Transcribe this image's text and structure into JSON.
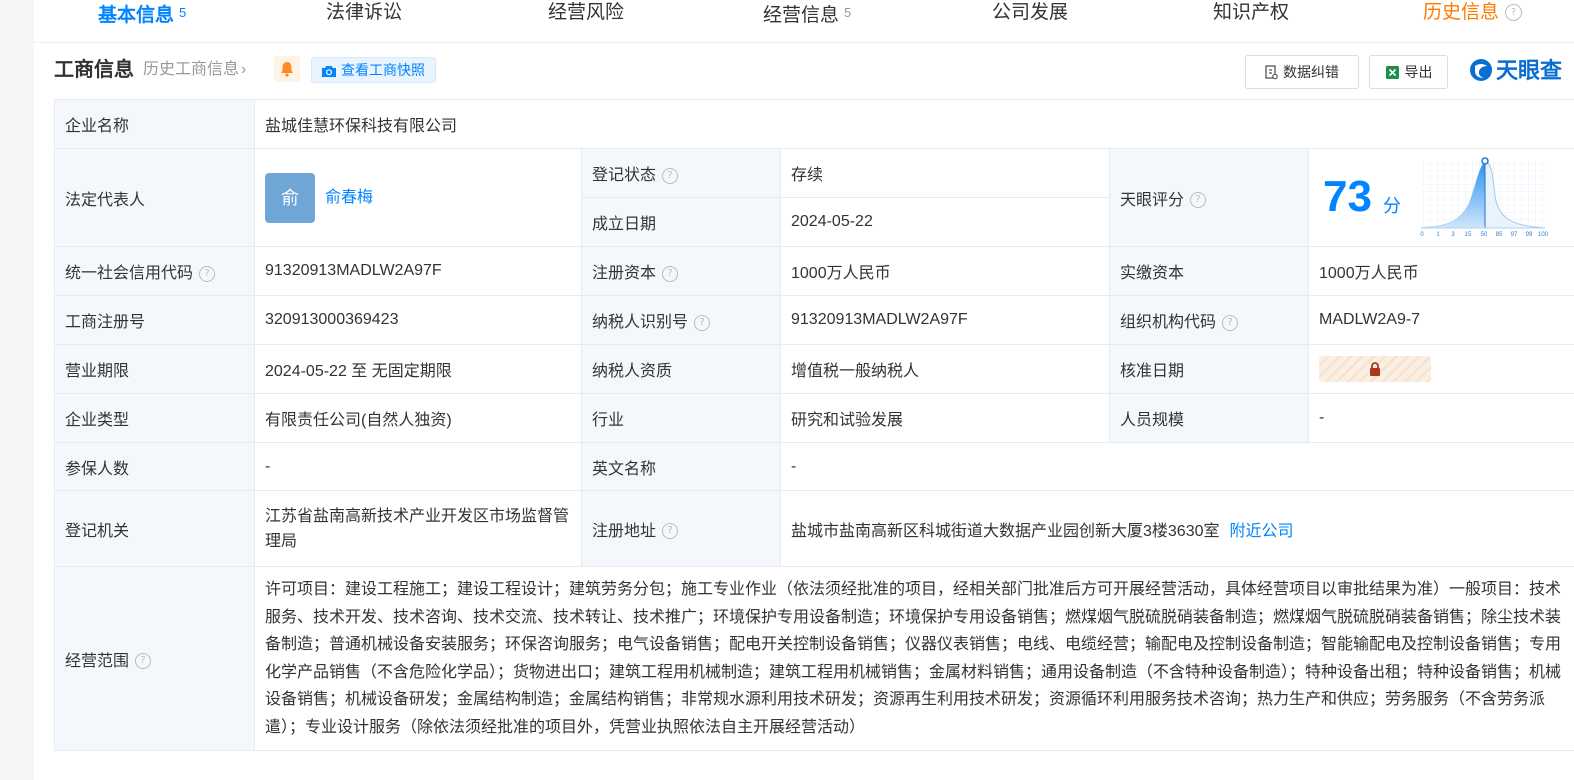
{
  "tabs": [
    {
      "label": "基本信息",
      "count": "5"
    },
    {
      "label": "法律诉讼"
    },
    {
      "label": "经营风险"
    },
    {
      "label": "经营信息",
      "count": "5"
    },
    {
      "label": "公司发展"
    },
    {
      "label": "知识产权"
    },
    {
      "label": "历史信息"
    }
  ],
  "section": {
    "title": "工商信息",
    "history_link": "历史工商信息",
    "snapshot_btn": "查看工商快照",
    "correct_btn": "数据纠错",
    "export_btn": "导出",
    "brand": "天眼查"
  },
  "info": {
    "company_name_label": "企业名称",
    "company_name": "盐城佳慧环保科技有限公司",
    "legal_rep_label": "法定代表人",
    "legal_rep_avatar": "俞",
    "legal_rep": "俞春梅",
    "reg_status_label": "登记状态",
    "reg_status": "存续",
    "found_date_label": "成立日期",
    "found_date": "2024-05-22",
    "score_label": "天眼评分",
    "score": "73",
    "score_unit": "分",
    "score_axis": [
      "0",
      "1",
      "3",
      "15",
      "50",
      "85",
      "97",
      "99",
      "100"
    ],
    "credit_code_label": "统一社会信用代码",
    "credit_code": "91320913MADLW2A97F",
    "reg_capital_label": "注册资本",
    "reg_capital": "1000万人民币",
    "paid_capital_label": "实缴资本",
    "paid_capital": "1000万人民币",
    "biz_reg_no_label": "工商注册号",
    "biz_reg_no": "320913000369423",
    "taxpayer_id_label": "纳税人识别号",
    "taxpayer_id": "91320913MADLW2A97F",
    "org_code_label": "组织机构代码",
    "org_code": "MADLW2A9-7",
    "term_label": "营业期限",
    "term": "2024-05-22 至 无固定期限",
    "tax_quality_label": "纳税人资质",
    "tax_quality": "增值税一般纳税人",
    "approve_date_label": "核准日期",
    "type_label": "企业类型",
    "type": "有限责任公司(自然人独资)",
    "industry_label": "行业",
    "industry": "研究和试验发展",
    "staff_size_label": "人员规模",
    "staff_size": "-",
    "insured_label": "参保人数",
    "insured": "-",
    "en_name_label": "英文名称",
    "en_name": "-",
    "authority_label": "登记机关",
    "authority": "江苏省盐南高新技术产业开发区市场监督管理局",
    "address_label": "注册地址",
    "address": "盐城市盐南高新区科城街道大数据产业园创新大厦3楼3630室",
    "nearby_link": "附近公司",
    "scope_label": "经营范围",
    "scope": "许可项目：建设工程施工；建设工程设计；建筑劳务分包；施工专业作业（依法须经批准的项目，经相关部门批准后方可开展经营活动，具体经营项目以审批结果为准）一般项目：技术服务、技术开发、技术咨询、技术交流、技术转让、技术推广；环境保护专用设备制造；环境保护专用设备销售；燃煤烟气脱硫脱硝装备制造；燃煤烟气脱硫脱硝装备销售；除尘技术装备制造；普通机械设备安装服务；环保咨询服务；电气设备销售；配电开关控制设备销售；仪器仪表销售；电线、电缆经营；输配电及控制设备制造；智能输配电及控制设备销售；专用化学产品销售（不含危险化学品）；货物进出口；建筑工程用机械制造；建筑工程用机械销售；金属材料销售；通用设备制造（不含特种设备制造）；特种设备出租；特种设备销售；机械设备销售；机械设备研发；金属结构制造；金属结构销售；非常规水源利用技术研发；资源再生利用技术研发；资源循环利用服务技术咨询；热力生产和供应；劳务服务（不含劳务派遣）；专业设计服务（除依法须经批准的项目外，凭营业执照依法自主开展经营活动）"
  },
  "colors": {
    "accent": "#0084ff",
    "status": "#00a854",
    "history_tab": "#ff7a00",
    "label_bg": "#f4f8fd"
  }
}
